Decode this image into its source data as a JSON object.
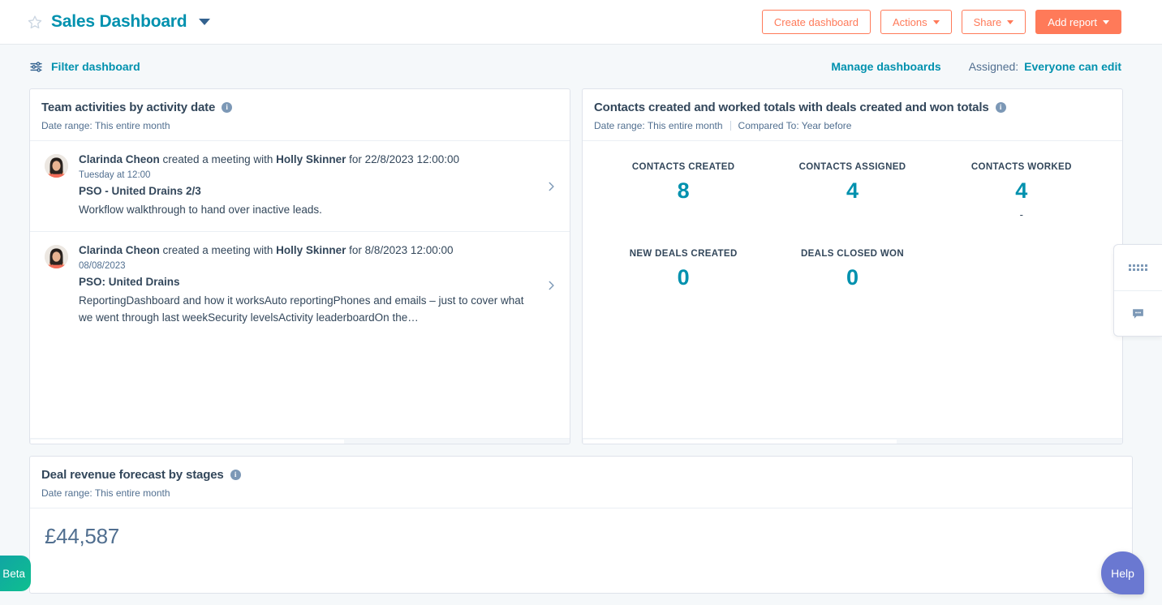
{
  "topbar": {
    "star_icon": "star-outline-icon",
    "title": "Sales Dashboard",
    "title_caret_icon": "chevron-down-icon",
    "buttons": [
      {
        "label": "Create dashboard",
        "has_caret": false,
        "style": "secondary"
      },
      {
        "label": "Actions",
        "has_caret": true,
        "style": "secondary"
      },
      {
        "label": "Share",
        "has_caret": true,
        "style": "secondary"
      },
      {
        "label": "Add report",
        "has_caret": true,
        "style": "primary"
      }
    ]
  },
  "filterbar": {
    "filter_icon": "sliders-icon",
    "filter_label": "Filter dashboard",
    "manage_label": "Manage dashboards",
    "assigned_label": "Assigned:",
    "assigned_value": "Everyone can edit"
  },
  "cards": {
    "activities": {
      "title": "Team activities by activity date",
      "info_icon": "info-icon",
      "subtitle": "Date range: This entire month",
      "items": [
        {
          "actor": "Clarinda Cheon",
          "action": " created a meeting with ",
          "target": "Holly Skinner",
          "suffix": " for 22/8/2023 12:00:00",
          "time": "Tuesday at 12:00",
          "subject": "PSO - United Drains 2/3",
          "description": "Workflow walkthrough to hand over inactive leads.",
          "chevron_icon": "chevron-right-icon"
        },
        {
          "actor": "Clarinda Cheon",
          "action": " created a meeting with ",
          "target": "Holly Skinner",
          "suffix": " for 8/8/2023 12:00:00",
          "time": "08/08/2023",
          "subject": "PSO: United Drains",
          "description": "ReportingDashboard and how it worksAuto reportingPhones and emails – just to cover what we went through last weekSecurity levelsActivity leaderboardOn the…",
          "chevron_icon": "chevron-right-icon"
        }
      ]
    },
    "totals": {
      "title": "Contacts created and worked totals with deals created and won totals",
      "info_icon": "info-icon",
      "subtitle_date": "Date range: This entire month",
      "subtitle_compare": "Compared To: Year before",
      "kpi_rows": [
        [
          {
            "label": "CONTACTS CREATED",
            "value": "8",
            "delta": ""
          },
          {
            "label": "CONTACTS ASSIGNED",
            "value": "4",
            "delta": ""
          },
          {
            "label": "CONTACTS WORKED",
            "value": "4",
            "delta": "-"
          }
        ],
        [
          {
            "label": "NEW DEALS CREATED",
            "value": "0",
            "delta": ""
          },
          {
            "label": "DEALS CLOSED WON",
            "value": "0",
            "delta": ""
          },
          {
            "label": "",
            "value": "",
            "delta": ""
          }
        ]
      ]
    },
    "revenue": {
      "title": "Deal revenue forecast by stages",
      "info_icon": "info-icon",
      "subtitle": "Date range: This entire month",
      "amount": "£44,587"
    }
  },
  "side_widget": {
    "grip_icon": "grip-dots-icon",
    "chat_icon": "chat-bubble-icon"
  },
  "beta_badge": {
    "label": "Beta"
  },
  "help_button": {
    "label": "Help"
  },
  "colors": {
    "brand_orange": "#ff7a59",
    "teal": "#0091ae",
    "slate": "#33475b",
    "muted": "#516f90",
    "page_bg": "#f5f8fa",
    "help_purple": "#6a78d1"
  }
}
